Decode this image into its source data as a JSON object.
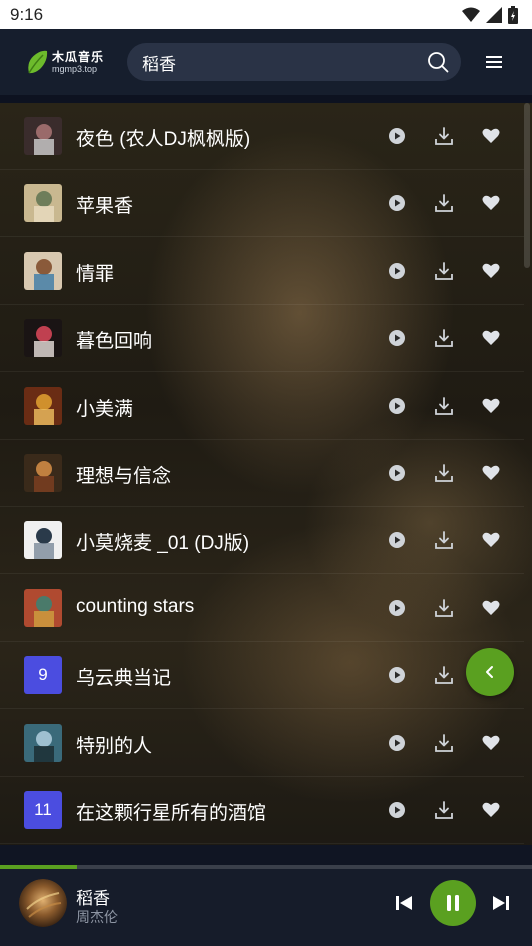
{
  "status": {
    "time": "9:16"
  },
  "app": {
    "logo_name": "木瓜音乐",
    "logo_domain": "mgmp3.top",
    "brand_color": "#5aa020"
  },
  "search": {
    "value": "稻香"
  },
  "songs": [
    {
      "title": "夜色 (农人DJ枫枫版)",
      "cover": "image"
    },
    {
      "title": "苹果香",
      "cover": "image"
    },
    {
      "title": "情罪",
      "cover": "image"
    },
    {
      "title": "暮色回响",
      "cover": "image"
    },
    {
      "title": "小美满",
      "cover": "image"
    },
    {
      "title": "理想与信念",
      "cover": "image"
    },
    {
      "title": "小莫烧麦 _01 (DJ版)",
      "cover": "image"
    },
    {
      "title": "counting stars",
      "cover": "image"
    },
    {
      "title": "乌云典当记",
      "cover": "number",
      "number": "9"
    },
    {
      "title": "特别的人",
      "cover": "image"
    },
    {
      "title": "在这颗行星所有的酒馆",
      "cover": "number",
      "number": "11"
    }
  ],
  "icons": {
    "row_actions": [
      "play-circle-icon",
      "download-icon",
      "heart-icon"
    ],
    "fab": "chevron-left-icon",
    "header": [
      "search-icon",
      "menu-icon"
    ],
    "player": [
      "skip-previous-icon",
      "pause-icon",
      "skip-next-icon"
    ]
  },
  "player": {
    "song": "稻香",
    "artist": "周杰伦",
    "progress": 0.145
  }
}
